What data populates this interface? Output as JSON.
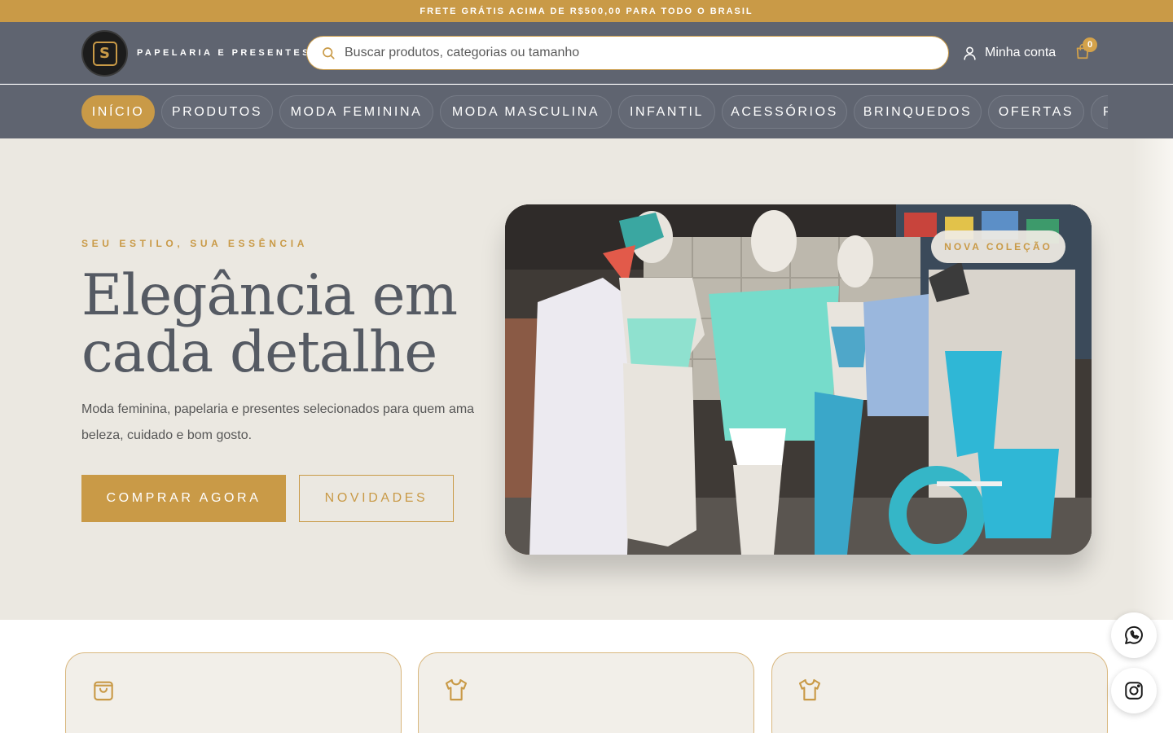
{
  "announcement": "FRETE GRÁTIS ACIMA DE R$500,00 PARA TODO O BRASIL",
  "header": {
    "brand_tagline": "PAPELARIA E PRESENTES",
    "search_placeholder": "Buscar produtos, categorias ou tamanho",
    "account_label": "Minha conta",
    "cart_count": "0"
  },
  "nav": {
    "items": [
      {
        "label": "INÍCIO",
        "active": true
      },
      {
        "label": "PRODUTOS"
      },
      {
        "label": "MODA FEMININA"
      },
      {
        "label": "MODA MASCULINA"
      },
      {
        "label": "INFANTIL"
      },
      {
        "label": "ACESSÓRIOS"
      },
      {
        "label": "BRINQUEDOS"
      },
      {
        "label": "OFERTAS"
      },
      {
        "label": "P"
      }
    ]
  },
  "hero": {
    "eyebrow": "SEU ESTILO, SUA ESSÊNCIA",
    "headline": "Elegância em cada detalhe",
    "subtitle": "Moda feminina, papelaria e presentes selecionados para quem ama beleza, cuidado e bom gosto.",
    "primary_button": "COMPRAR AGORA",
    "secondary_button": "NOVIDADES",
    "image_badge": "NOVA COLEÇÃO"
  },
  "feature_cards": [
    {
      "icon": "shopping-bag-icon"
    },
    {
      "icon": "shirt-icon"
    },
    {
      "icon": "shirt-icon"
    }
  ],
  "floating": [
    {
      "icon": "whatsapp-icon"
    },
    {
      "icon": "instagram-icon"
    }
  ],
  "colors": {
    "accent_gold": "#c99a47",
    "header_slate": "#5f6470",
    "hero_bg": "#ebe8e1"
  }
}
